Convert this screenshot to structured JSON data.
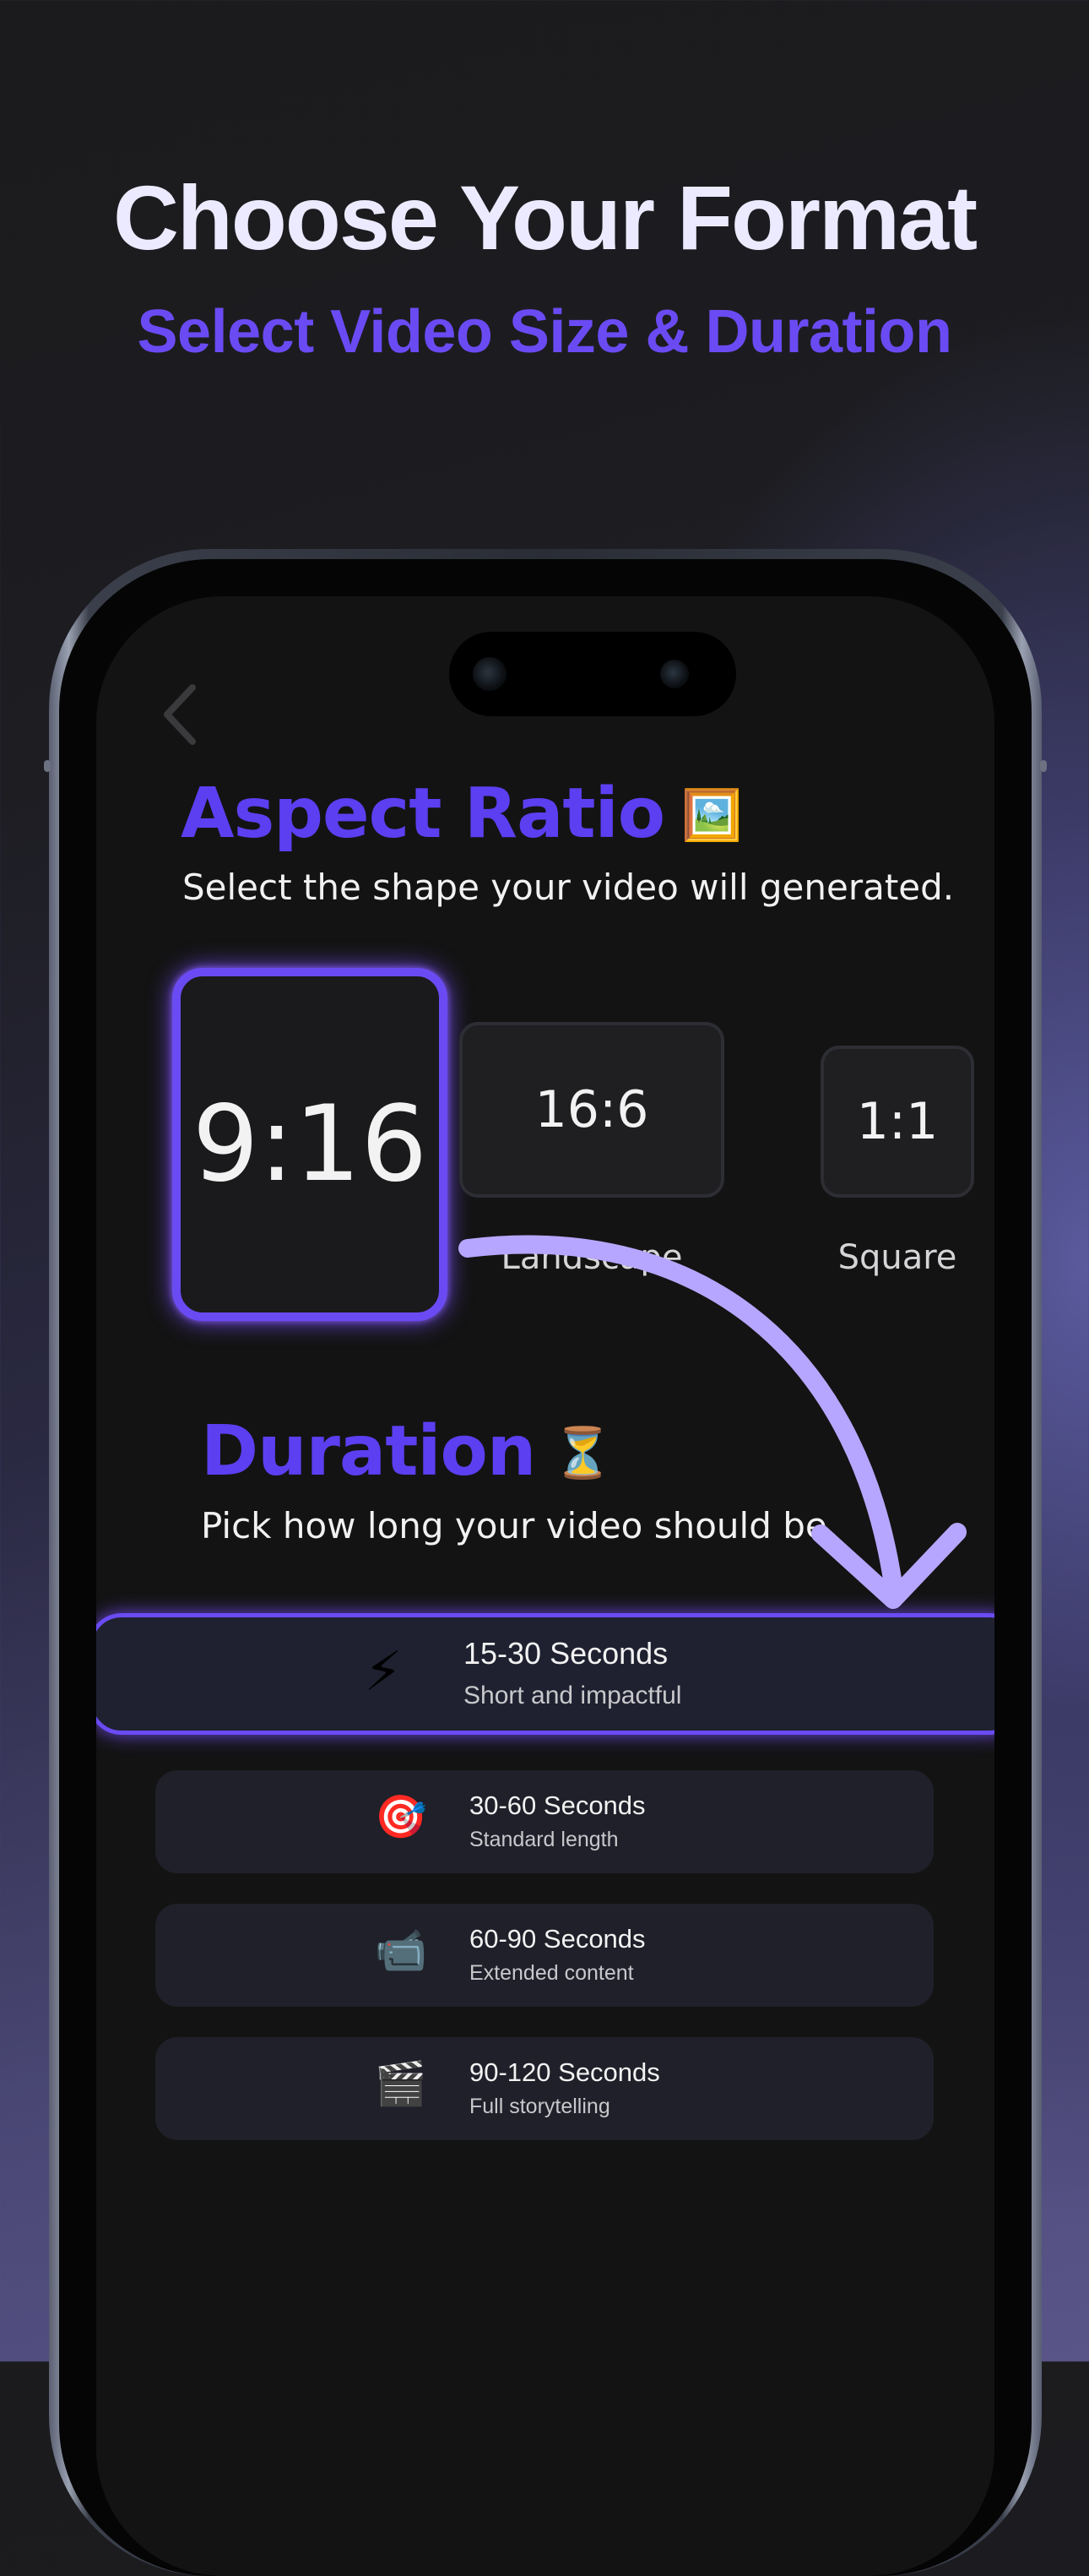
{
  "header": {
    "title": "Choose Your Format",
    "subtitle": "Select Video Size & Duration"
  },
  "aspect": {
    "title": "Aspect Ratio",
    "emoji": "🖼️",
    "description": "Select the shape your video will generated.",
    "options": [
      {
        "ratio": "9:16",
        "label": "",
        "selected": true
      },
      {
        "ratio": "16:6",
        "label": "Landscape",
        "selected": false
      },
      {
        "ratio": "1:1",
        "label": "Square",
        "selected": false
      }
    ]
  },
  "duration": {
    "title": "Duration",
    "emoji": "⏳",
    "description": "Pick how long your video should be.",
    "options": [
      {
        "icon": "⚡",
        "icon_name": "lightning-icon",
        "title": "15-30 Seconds",
        "desc": "Short and impactful",
        "selected": true
      },
      {
        "icon": "🎯",
        "icon_name": "target-icon",
        "title": "30-60 Seconds",
        "desc": "Standard length",
        "selected": false
      },
      {
        "icon": "📹",
        "icon_name": "video-camera-icon",
        "title": "60-90 Seconds",
        "desc": "Extended content",
        "selected": false
      },
      {
        "icon": "🎬",
        "icon_name": "clapperboard-icon",
        "title": "90-120 Seconds",
        "desc": "Full storytelling",
        "selected": false
      }
    ]
  },
  "colors": {
    "accent": "#6a4bf3",
    "arrow": "#b7a6ff",
    "screen_bg": "#131313"
  }
}
